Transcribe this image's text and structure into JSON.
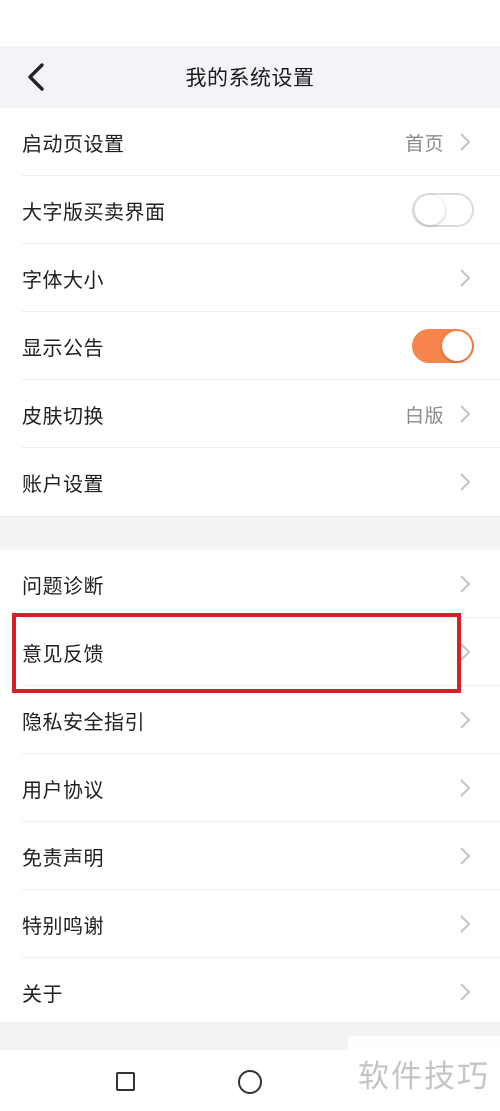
{
  "header": {
    "title": "我的系统设置"
  },
  "group1": [
    {
      "label": "启动页设置",
      "value": "首页"
    },
    {
      "label": "大字版买卖界面",
      "toggle": "off"
    },
    {
      "label": "字体大小"
    },
    {
      "label": "显示公告",
      "toggle": "on"
    },
    {
      "label": "皮肤切换",
      "value": "白版"
    },
    {
      "label": "账户设置"
    }
  ],
  "group2": [
    {
      "label": "问题诊断"
    },
    {
      "label": "意见反馈"
    },
    {
      "label": "隐私安全指引"
    },
    {
      "label": "用户协议"
    },
    {
      "label": "免责声明"
    },
    {
      "label": "特别鸣谢"
    },
    {
      "label": "关于"
    }
  ],
  "watermark": "软件技巧",
  "colors": {
    "toggle_on": "#f7844a",
    "highlight": "#d7202a"
  },
  "icons": {
    "back": "chevron-left-icon",
    "row": "chevron-right-icon"
  }
}
